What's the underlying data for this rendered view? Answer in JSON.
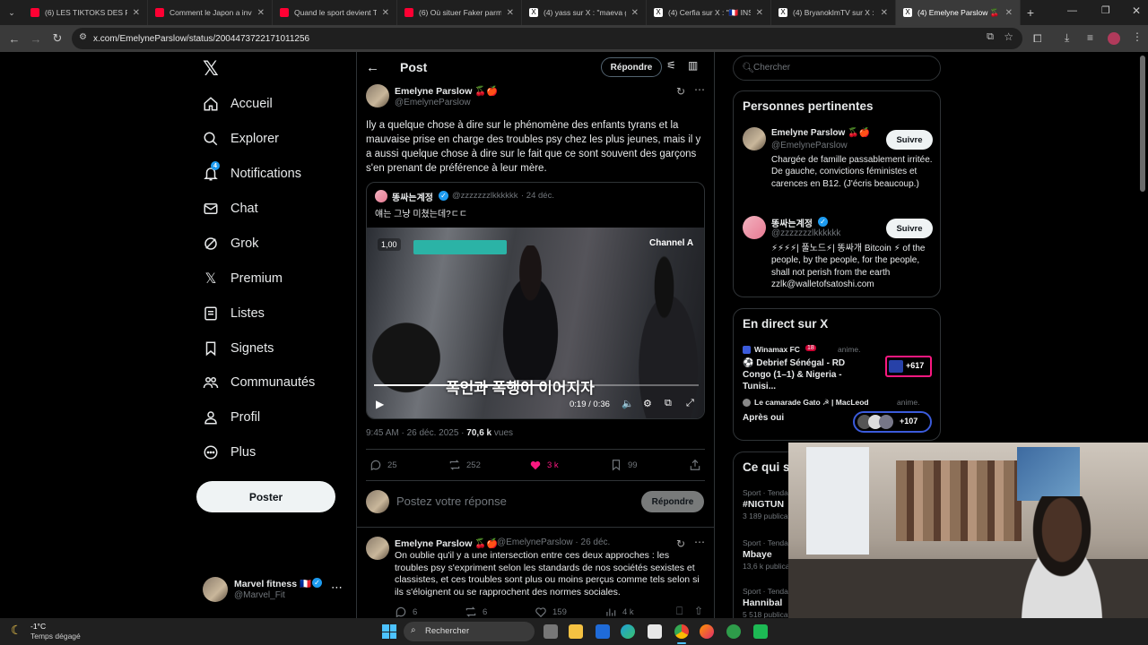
{
  "browser": {
    "tabs": [
      {
        "label": "(6) LES TIKTOKS DES POLI",
        "color": "#ff0033"
      },
      {
        "label": "Comment le Japon a inve",
        "color": "#ff0033"
      },
      {
        "label": "Quand le sport devient TC",
        "color": "#ff0033"
      },
      {
        "label": "(6) Où situer Faker parmi",
        "color": "#ff0033"
      },
      {
        "label": "(4) yass sur X : \"maeva gh",
        "color": "#ffffff"
      },
      {
        "label": "(4) Cerfia sur X : \"🇫🇷 INSO",
        "color": "#ffffff"
      },
      {
        "label": "(4) BryanoklmTV sur X : \"J",
        "color": "#ffffff"
      },
      {
        "label": "(4) Emelyne Parslow 🍒🍎",
        "color": "#ffffff"
      }
    ],
    "url": "x.com/EmelyneParslow/status/2004473722171011256"
  },
  "sidebar": {
    "items": [
      {
        "label": "Accueil",
        "icon": "home-icon"
      },
      {
        "label": "Explorer",
        "icon": "search-icon"
      },
      {
        "label": "Notifications",
        "icon": "bell-icon",
        "badge": "4"
      },
      {
        "label": "Chat",
        "icon": "mail-icon"
      },
      {
        "label": "Grok",
        "icon": "grok-icon"
      },
      {
        "label": "Premium",
        "icon": "x-logo-icon"
      },
      {
        "label": "Listes",
        "icon": "list-icon"
      },
      {
        "label": "Signets",
        "icon": "bookmark-icon"
      },
      {
        "label": "Communautés",
        "icon": "communities-icon"
      },
      {
        "label": "Profil",
        "icon": "person-icon"
      },
      {
        "label": "Plus",
        "icon": "more-circle-icon"
      }
    ],
    "post_label": "Poster",
    "account": {
      "name": "Marvel fitness 🇫🇷",
      "handle": "@Marvel_Fit"
    }
  },
  "header": {
    "title": "Post",
    "reply_label": "Répondre"
  },
  "tweet": {
    "name": "Emelyne Parslow 🍒🍎",
    "handle": "@EmelyneParslow",
    "text": "Ily a quelque chose à dire sur le phénomène des enfants tyrans et la mauvaise prise en charge des troubles psy chez les plus jeunes, mais il y a aussi quelque chose à dire sur le fait que ce sont souvent des garçons s'en prenant de préférence à leur mère.",
    "quote": {
      "name": "똥싸는계정",
      "handle": "@zzzzzzzlkkkkkk",
      "date": "· 24 déc.",
      "text": "얘는 그냥 미쳤는데?ㄷㄷ",
      "video": {
        "speed": "1,00",
        "channel": "Channel A",
        "caption": "폭언과 폭행이 이어지자",
        "time": "0:19 / 0:36",
        "progress": 0.53
      }
    },
    "meta_time": "9:45 AM · 26 déc. 2025 · ",
    "meta_views": "70,6 k",
    "meta_views_label": " vues",
    "stats": {
      "replies": "25",
      "reposts": "252",
      "likes": "3 k",
      "bookmarks": "99"
    },
    "reply_placeholder": "Postez votre réponse",
    "reply_button": "Répondre"
  },
  "reply_tweet": {
    "name": "Emelyne Parslow 🍒🍎",
    "handle": "@EmelyneParslow · 26 déc.",
    "text": "On oublie qu'il y a une intersection entre ces deux approches : les troubles psy s'expriment selon les standards de nos sociétés sexistes et classistes, et ces troubles sont plus ou moins perçus comme tels selon si ils s'éloignent ou se rapprochent des normes sociales.",
    "stats": {
      "replies": "6",
      "reposts": "6",
      "likes": "159",
      "views": "4 k"
    }
  },
  "right": {
    "search_placeholder": "Chercher",
    "relevant_title": "Personnes pertinentes",
    "people": [
      {
        "name": "Emelyne Parslow 🍒🍎",
        "handle": "@EmelyneParslow",
        "bio": "Chargée de famille passablement irritée. De gauche, convictions féministes et carences en B12. (J'écris beaucoup.)",
        "follow": "Suivre"
      },
      {
        "name": "똥싸는계정",
        "handle": "@zzzzzzzlkkkkkk",
        "bio": "⚡⚡⚡⚡| 풀노드⚡| 똥싸개 Bitcoin ⚡ of the people, by the people, for the people, shall not perish from the earth zzlk@walletofsatoshi.com",
        "follow": "Suivre"
      }
    ],
    "live_title": "En direct sur X",
    "live": [
      {
        "host": "Winamax FC",
        "tag": "18",
        "status": "anime.",
        "title": "⚽ Debrief Sénégal - RD Congo (1–1) & Nigeria - Tunisi...",
        "count": "+617"
      },
      {
        "host": "Le camarade Gato ☭ | MacLeod",
        "status": "anime.",
        "title": "Après oui",
        "count": "+107"
      }
    ],
    "trends_title": "Ce qui se passe",
    "trends": [
      {
        "cat": "Sport · Tendances",
        "name": "#NIGTUN",
        "count": "3 189 publications"
      },
      {
        "cat": "Sport · Tendances",
        "name": "Mbaye",
        "count": "13,6 k publications"
      },
      {
        "cat": "Sport · Tendances",
        "name": "Hannibal",
        "count": "5 518 publications"
      }
    ]
  },
  "taskbar": {
    "weather_temp": "-1°C",
    "weather_desc": "Temps dégagé",
    "search_label": "Rechercher"
  }
}
